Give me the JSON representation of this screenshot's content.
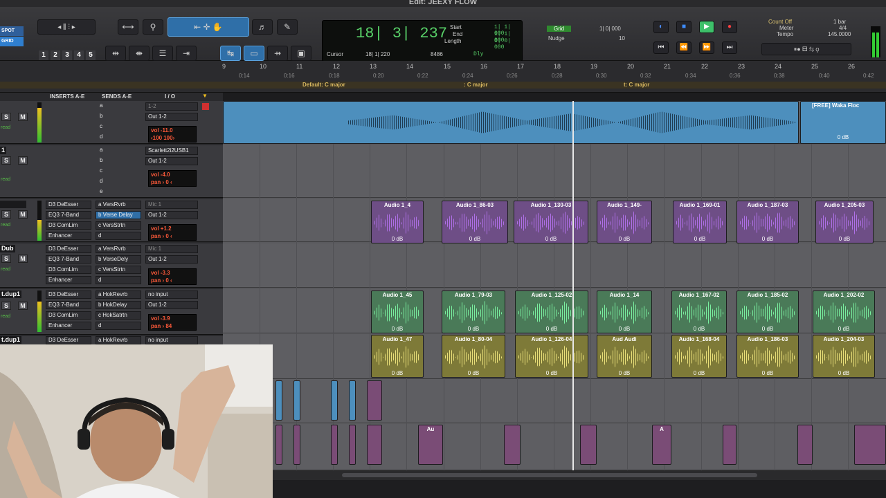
{
  "window": {
    "title": "Edit: JEEXY FLOW"
  },
  "toolbar": {
    "modes": [
      "SPOT",
      "GRID"
    ],
    "zoom_presets": [
      "1",
      "2",
      "3",
      "4",
      "5"
    ],
    "counter": {
      "main": "18| 3| 237",
      "start_label": "Start",
      "end_label": "End",
      "length_label": "Length",
      "start": "1| 1| 000",
      "end": "1| 1| 000",
      "length": "0| 0| 000",
      "cursor_label": "Cursor",
      "cursor": "18| 1| 220",
      "sample": "8486",
      "dly_label": "Dly"
    },
    "grid": {
      "label": "Grid",
      "value": "1| 0| 000",
      "nudge_label": "Nudge",
      "nudge_value": "10"
    },
    "count_off": "Count Off",
    "count_bars": "1 bar",
    "meter_label": "Meter",
    "meter": "4/4",
    "tempo_label": "Tempo",
    "tempo": "145.0000"
  },
  "ruler": {
    "bars": [
      "9",
      "10",
      "11",
      "12",
      "13",
      "14",
      "15",
      "16",
      "17",
      "18",
      "19",
      "20",
      "21",
      "22",
      "23",
      "24",
      "25",
      "26"
    ],
    "minsecs": [
      "0:14",
      "0:16",
      "0:18",
      "0:20",
      "0:22",
      "0:24",
      "0:26",
      "0:28",
      "0:30",
      "0:32",
      "0:34",
      "0:36",
      "0:38",
      "0:40",
      "0:42"
    ],
    "key_default": "Default: C major",
    "key_2": ": C major",
    "key_3": "t: C major"
  },
  "mixer_headers": {
    "inserts": "INSERTS A-E",
    "sends": "SENDS A-E",
    "io": "I / O"
  },
  "tracks": [
    {
      "name": "",
      "inserts": [],
      "sends": [
        "a",
        "b",
        "c",
        "d"
      ],
      "input": "1-2",
      "output": "Out 1-2",
      "vol": "vol  -11.0",
      "pan": "‹100  100›",
      "read": "read"
    },
    {
      "name": "1",
      "inserts": [],
      "sends": [
        "a",
        "b",
        "c",
        "d",
        "e"
      ],
      "input": "Scarlett2i2USB1",
      "output": "Out 1-2",
      "vol": "vol  -4.0",
      "pan": "pan  › 0 ‹",
      "read": "read"
    },
    {
      "name": "",
      "inserts": [
        "D3 DeEsser",
        "EQ3 7-Band",
        "D3 ComLim",
        "Enhancer"
      ],
      "sends": [
        "a VersRvrb",
        "b Verse Delay",
        "c VersStrtn",
        "d"
      ],
      "input": "Mic 1",
      "output": "Out 1-2",
      "vol": "vol  +1.2",
      "pan": "pan  › 0 ‹",
      "read": "read"
    },
    {
      "name": "Dub",
      "inserts": [
        "D3 DeEsser",
        "EQ3 7-Band",
        "D3 ComLim",
        "Enhancer"
      ],
      "sends": [
        "a VersRvrb",
        "b VerseDely",
        "c VersStrtn",
        "d"
      ],
      "input": "Mic 1",
      "output": "Out 1-2",
      "vol": "vol  -3.3",
      "pan": "pan  › 0 ‹",
      "read": "read"
    },
    {
      "name": "t.dup1",
      "inserts": [
        "D3 DeEsser",
        "EQ3 7-Band",
        "D3 ComLim",
        "Enhancer"
      ],
      "sends": [
        "a HokRevrb",
        "b HokDelay",
        "c HokSatrtn",
        "d"
      ],
      "input": "no input",
      "output": "Out 1-2",
      "vol": "vol  -3.9",
      "pan": "pan  › 84",
      "read": "read"
    },
    {
      "name": "t.dup1",
      "inserts": [
        "D3 DeEsser"
      ],
      "sends": [
        "a HokRevrb"
      ],
      "input": "no input",
      "output": "",
      "vol": "",
      "pan": "",
      "read": ""
    }
  ],
  "regions": {
    "beat": {
      "name": "[FREE] Waka Floc",
      "gain": "0 dB"
    },
    "row_purple": [
      {
        "name": "Audio 1_4",
        "gain": "0 dB"
      },
      {
        "name": "Audio 1_86-03",
        "gain": "0 dB"
      },
      {
        "name": "Audio 1_130-03",
        "gain": "0 dB"
      },
      {
        "name": "Audio 1_149-",
        "gain": "0 dB"
      },
      {
        "name": "Audio 1_169-01",
        "gain": "0 dB"
      },
      {
        "name": "Audio 1_187-03",
        "gain": "0 dB"
      },
      {
        "name": "Audio 1_205-03",
        "gain": "0 dB"
      }
    ],
    "row_green": [
      {
        "name": "Audio 1_45",
        "gain": "0 dB"
      },
      {
        "name": "Audio 1_79-03",
        "gain": "0 dB"
      },
      {
        "name": "Audio 1_125-02",
        "gain": "0 dB"
      },
      {
        "name": "Audio 1_14",
        "gain": "0 dB"
      },
      {
        "name": "Audio 1_167-02",
        "gain": "0 dB"
      },
      {
        "name": "Audio 1_185-02",
        "gain": "0 dB"
      },
      {
        "name": "Audio 1_202-02",
        "gain": "0 dB"
      }
    ],
    "row_yellow": [
      {
        "name": "Audio 1_47",
        "gain": "0 dB"
      },
      {
        "name": "Audio 1_80-04",
        "gain": "0 dB"
      },
      {
        "name": "Audio 1_126-04",
        "gain": "0 dB"
      },
      {
        "name": "Aud  Audi",
        "gain": "0 dB"
      },
      {
        "name": "Audio 1_168-04",
        "gain": "0 dB"
      },
      {
        "name": "Audio 1_186-03",
        "gain": "0 dB"
      },
      {
        "name": "Audio 1_204-03",
        "gain": "0 dB"
      }
    ],
    "small_labels": [
      "Au",
      "A"
    ]
  },
  "colors": {
    "accent_blue": "#2f6fa8",
    "counter_green": "#58d068",
    "volume_red": "#ff5a3a"
  }
}
